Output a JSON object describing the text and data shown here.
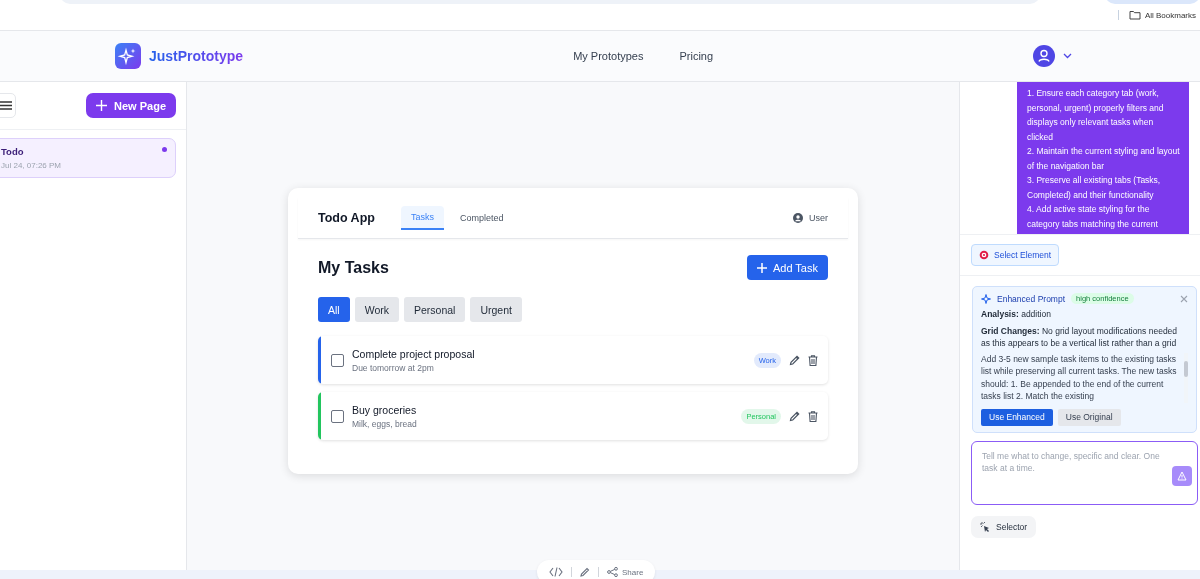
{
  "browser": {
    "bookmarks_label": "All Bookmarks"
  },
  "header": {
    "brand": "JustPrototype",
    "nav": [
      {
        "label": "My Prototypes"
      },
      {
        "label": "Pricing"
      }
    ]
  },
  "sidebar": {
    "new_button": "New Page",
    "pages": [
      {
        "title": "Todo",
        "date": "Jul 24, 07:26 PM",
        "selected": true
      }
    ]
  },
  "preview": {
    "app_title": "Todo App",
    "tabs": [
      {
        "label": "Tasks",
        "selected": true
      },
      {
        "label": "Completed",
        "selected": false
      }
    ],
    "user_label": "User",
    "heading": "My Tasks",
    "add_button": "Add Task",
    "filters": [
      {
        "label": "All",
        "selected": true
      },
      {
        "label": "Work",
        "selected": false
      },
      {
        "label": "Personal",
        "selected": false
      },
      {
        "label": "Urgent",
        "selected": false
      }
    ],
    "tasks": [
      {
        "title": "Complete project proposal",
        "note": "Due tomorrow at 2pm",
        "tag": "Work",
        "color": "#2563eb",
        "checked": false
      },
      {
        "title": "Buy groceries",
        "note": "Milk, eggs, bread",
        "tag": "Personal",
        "color": "#22c55e",
        "checked": false
      }
    ]
  },
  "chat": {
    "message_lines": [
      "1. Ensure each category tab (work, personal, urgent) properly filters and displays only relevant tasks when clicked",
      "2. Maintain the current styling and layout of the navigation bar",
      "3. Preserve all existing tabs (Tasks, Completed) and their functionality",
      "4. Add active state styling for the category tabs matching the current"
    ],
    "select_button": "Select Element",
    "enhanced": {
      "title": "Enhanced Prompt",
      "badge": "high confidence",
      "analysis": "**Analysis:** addition",
      "grid_changes": "**Grid Changes:** No grid layout modifications needed as this appears to be a vertical list rather than a grid",
      "body": "Add 3-5 new sample task items to the existing tasks list while preserving all current tasks. The new tasks should: 1. Be appended to the end of the current tasks list 2. Match the existing",
      "buttons": [
        {
          "label": "Use Enhanced",
          "selected": true
        },
        {
          "label": "Use Original",
          "selected": false
        }
      ]
    },
    "input_placeholder": "Tell me what to change, specific and clear. One task at a time.",
    "selector_button": "Selector"
  },
  "toolbar": {
    "share_label": "Share"
  }
}
